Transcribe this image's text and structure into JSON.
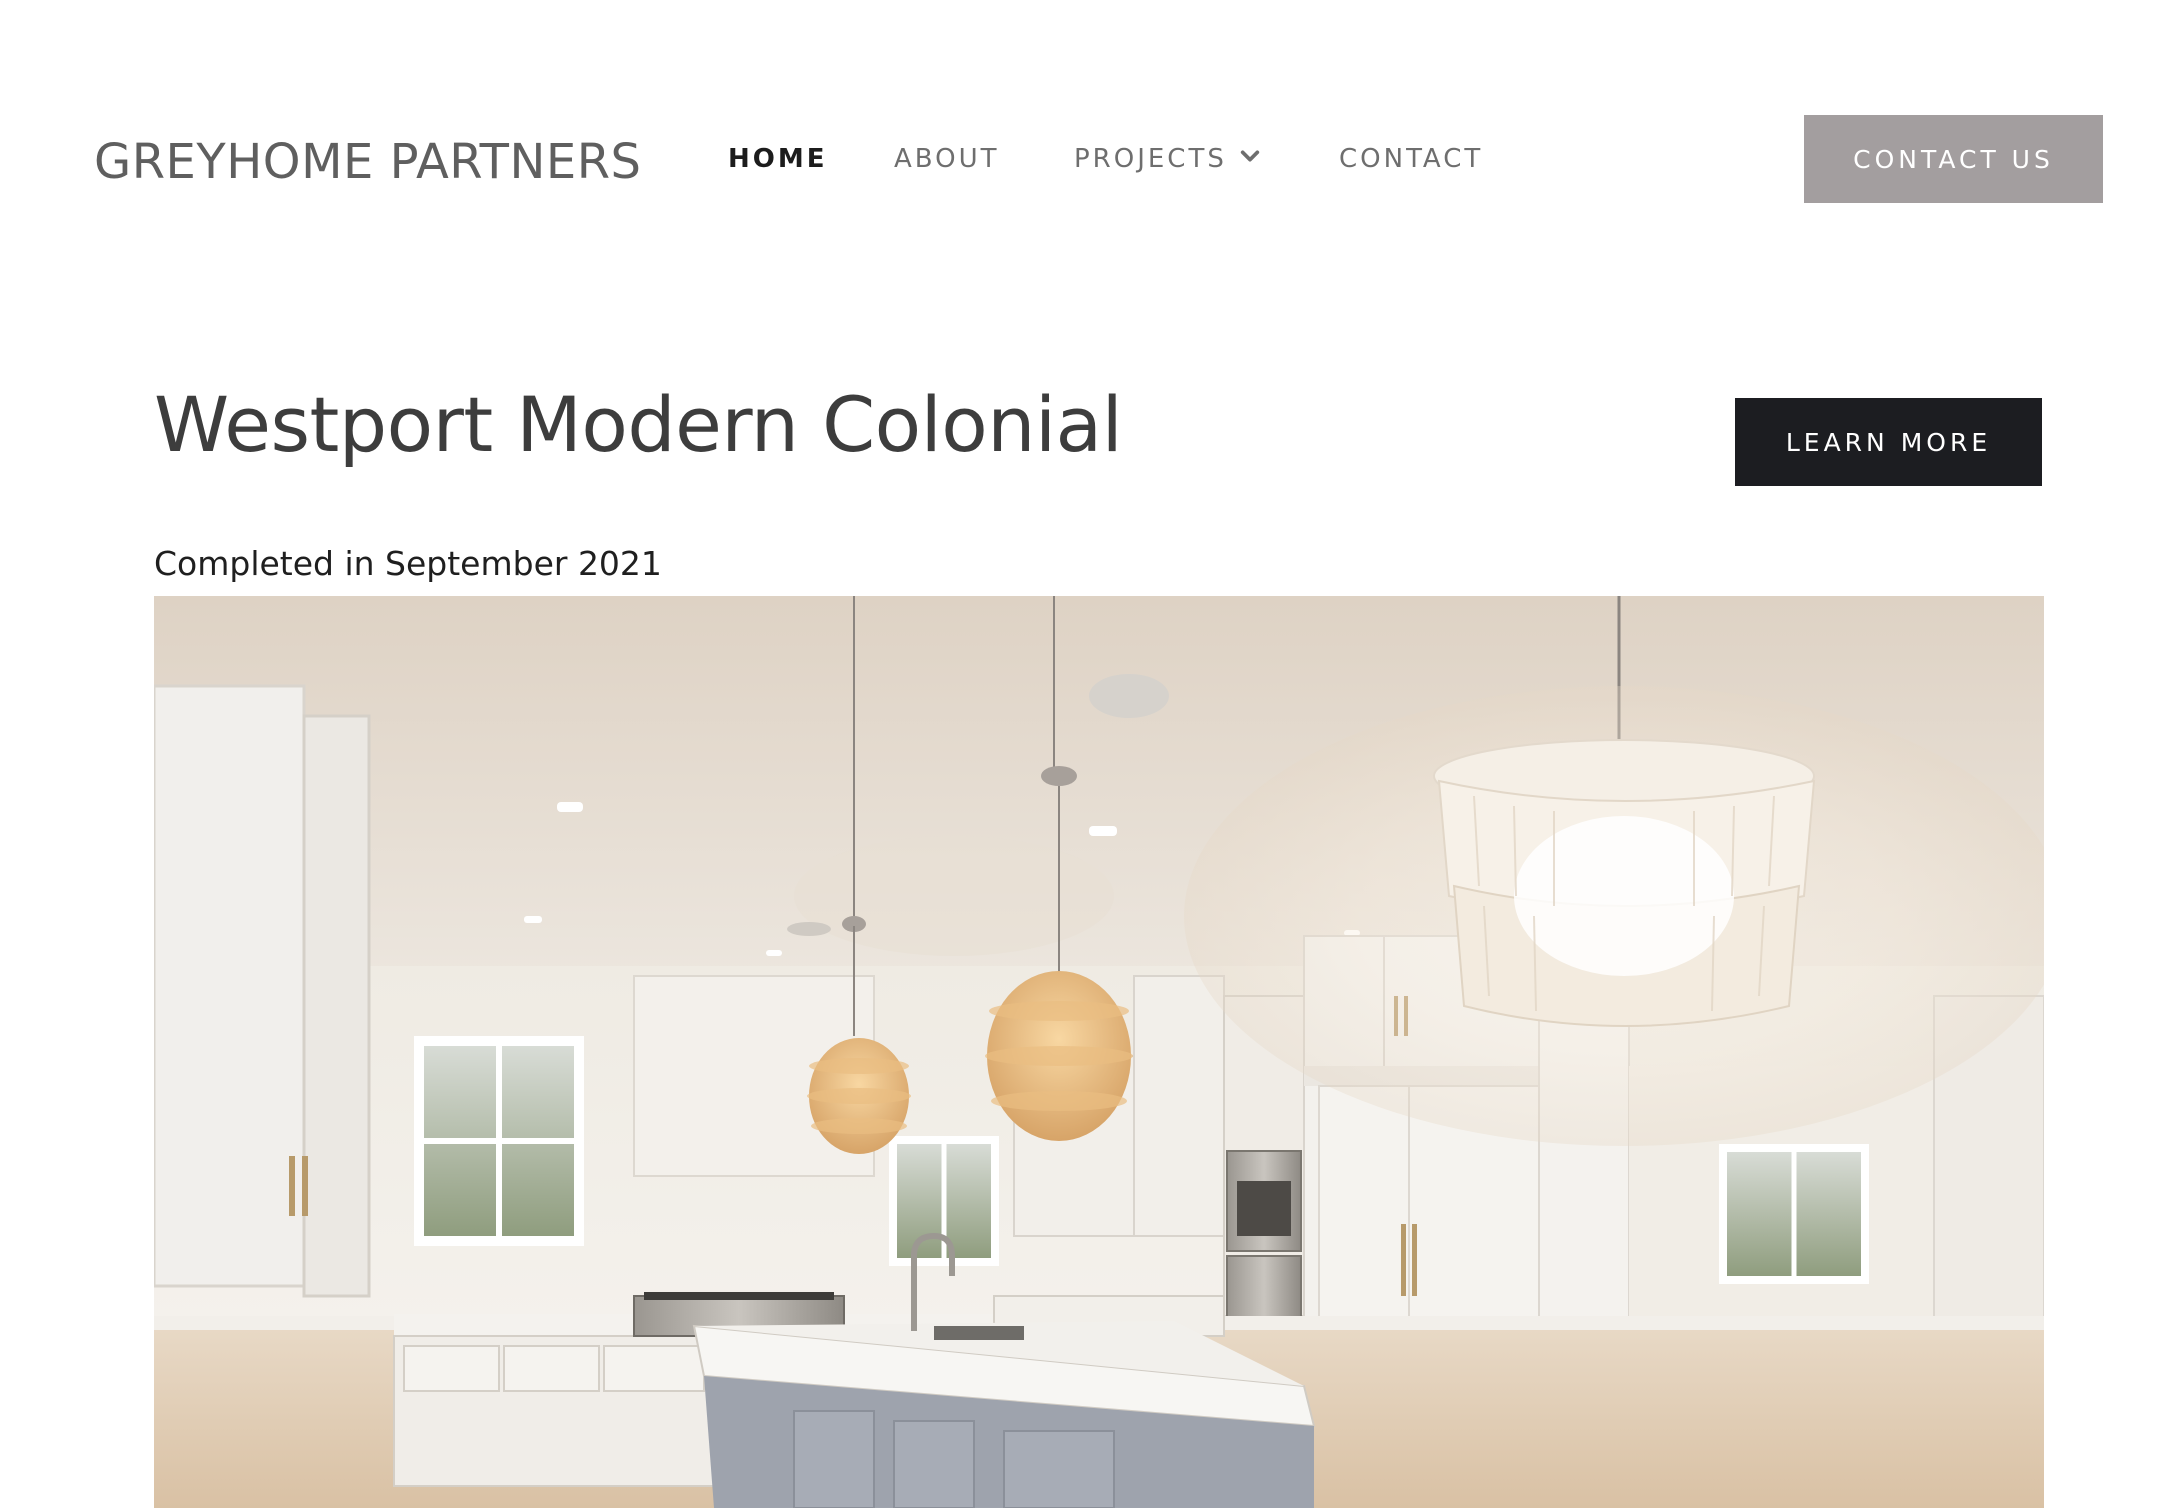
{
  "header": {
    "logo_text": "GREYHOME PARTNERS",
    "nav": {
      "home": "HOME",
      "about": "ABOUT",
      "projects": "PROJECTS",
      "contact": "CONTACT"
    },
    "projects_dropdown_icon": "chevron-down-icon",
    "cta_label": "CONTACT US"
  },
  "project": {
    "title": "Westport Modern Colonial",
    "learn_more_label": "LEARN MORE",
    "completed_text": "Completed in September 2021",
    "photo_subject": "kitchen-interior-photo"
  },
  "colors": {
    "cta_background": "#a39e9f",
    "learn_more_background": "#1c1d21",
    "active_nav": "#1c1c1c",
    "inactive_nav": "#6e6e6e"
  }
}
